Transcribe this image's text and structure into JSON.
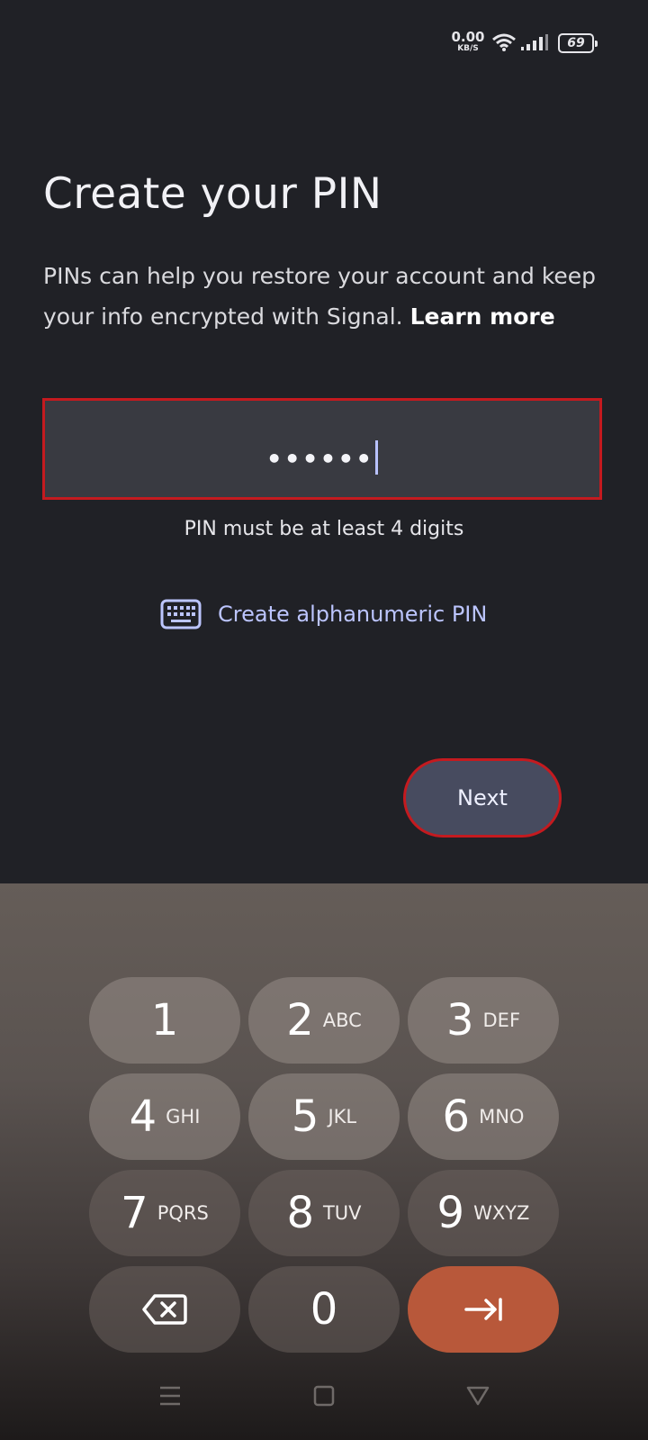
{
  "status_bar": {
    "net_speed": "0.00",
    "net_unit": "KB/S",
    "battery": "69"
  },
  "screen": {
    "title": "Create your PIN",
    "description": "PINs can help you restore your account and keep your info encrypted with Signal.",
    "learn_more": "Learn more",
    "pin_value": "••••••",
    "pin_helper": "PIN must be at least 4 digits",
    "alphanumeric_link": "Create alphanumeric PIN",
    "next_label": "Next"
  },
  "keypad": {
    "keys": [
      {
        "digit": "1",
        "letters": ""
      },
      {
        "digit": "2",
        "letters": "ABC"
      },
      {
        "digit": "3",
        "letters": "DEF"
      },
      {
        "digit": "4",
        "letters": "GHI"
      },
      {
        "digit": "5",
        "letters": "JKL"
      },
      {
        "digit": "6",
        "letters": "MNO"
      },
      {
        "digit": "7",
        "letters": "PQRS"
      },
      {
        "digit": "8",
        "letters": "TUV"
      },
      {
        "digit": "9",
        "letters": "WXYZ"
      },
      {
        "digit": "0",
        "letters": ""
      }
    ]
  },
  "colors": {
    "background": "#202126",
    "accent_link": "#bcc5ff",
    "highlight_border": "#c41a1f",
    "enter_key": "#b8583a"
  },
  "icons": {
    "keyboard": "keyboard-icon",
    "backspace": "backspace-icon",
    "enter": "tab-arrow-icon",
    "nav_menu": "menu-icon",
    "nav_home": "home-square-icon",
    "nav_back": "back-triangle-icon"
  }
}
